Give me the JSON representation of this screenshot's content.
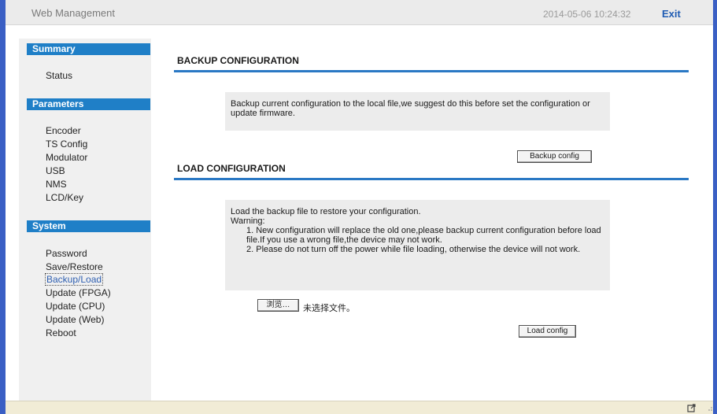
{
  "header": {
    "title": "Web Management",
    "datetime": "2014-05-06 10:24:32",
    "exit_label": "Exit"
  },
  "sidebar": {
    "summary": {
      "title": "Summary",
      "items": [
        "Status"
      ]
    },
    "parameters": {
      "title": "Parameters",
      "items": [
        "Encoder",
        "TS Config",
        "Modulator",
        "USB",
        "NMS",
        "LCD/Key"
      ]
    },
    "system": {
      "title": "System",
      "items": [
        "Password",
        "Save/Restore",
        "Backup/Load",
        "Update (FPGA)",
        "Update (CPU)",
        "Update (Web)",
        "Reboot"
      ],
      "active": "Backup/Load"
    }
  },
  "backup": {
    "title": "BACKUP CONFIGURATION",
    "description": "Backup current configuration to the local file,we suggest do this before set the configuration or update firmware.",
    "button_label": "Backup config"
  },
  "load": {
    "title": "LOAD CONFIGURATION",
    "description": "Load the backup file to restore your configuration.",
    "warning_label": "Warning:",
    "warning_1": "1. New configuration will replace the old one,please backup current configuration before load file.If you use a wrong file,the device may not work.",
    "warning_2": "2. Please do not turn off the power while file loading, otherwise the device will not work.",
    "browse_label": "浏览…",
    "file_status": "未选择文件。",
    "button_label": "Load config"
  },
  "colors": {
    "frame": "#3a5fc4",
    "section_header": "#1f7fc7",
    "rule": "#2a78c4",
    "exit": "#1f5cb3",
    "statusbar": "#f1ecd6"
  },
  "icons": [
    "share-icon",
    "resize-grip-icon"
  ]
}
